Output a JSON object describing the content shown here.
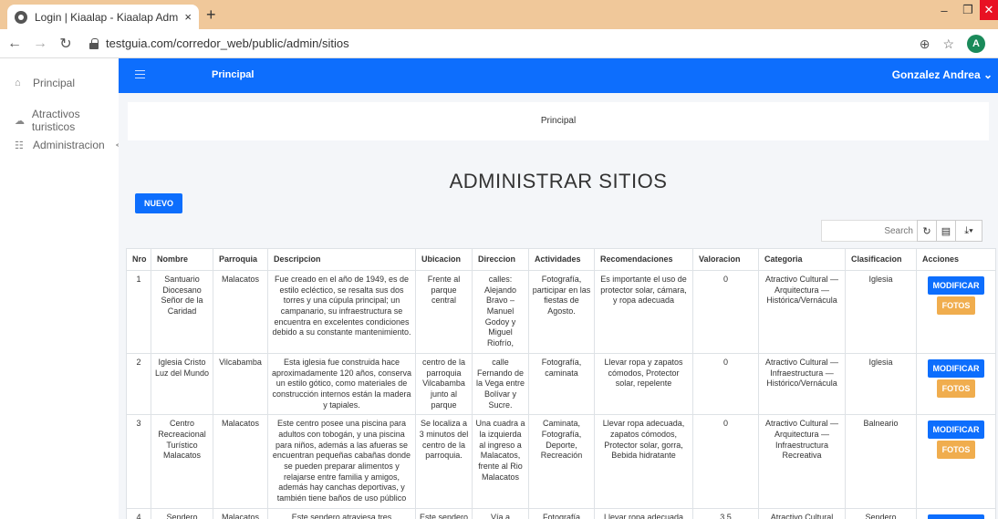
{
  "browser": {
    "tab_title": "Login | Kiaalap - Kiaalap Admin T",
    "close": "×",
    "new_tab": "+",
    "url": "testguia.com/corredor_web/public/admin/sitios",
    "avatar_letter": "A"
  },
  "sidebar": {
    "items": [
      {
        "label": "Principal",
        "icon": "home-icon"
      },
      {
        "label": "Atractivos turisticos",
        "icon": "cloud-icon"
      },
      {
        "label": "Administracion",
        "icon": "admin-icon",
        "caret": "<"
      }
    ]
  },
  "topnav": {
    "title": "Principal",
    "user": "Gonzalez Andrea ⌄"
  },
  "breadcrumb": "Principal",
  "page_title": "ADMINISTRAR SITIOS",
  "nuevo_label": "NUEVO",
  "search_placeholder": "Search",
  "table": {
    "headers": [
      "Nro",
      "Nombre",
      "Parroquia",
      "Descripcion",
      "Ubicacion",
      "Direccion",
      "Actividades",
      "Recomendaciones",
      "Valoracion",
      "Categoria",
      "Clasificacion",
      "Acciones"
    ],
    "rows": [
      {
        "nro": "1",
        "nombre": "Santuario Diocesano Señor de la Caridad",
        "parroquia": "Malacatos",
        "descripcion": "Fue creado en el año de 1949, es de estilo ecléctico, se resalta sus dos torres y una cúpula principal; un campanario, su infraestructura se encuentra en excelentes condiciones debido a su constante mantenimiento.",
        "ubicacion": "Frente al parque central",
        "direccion": "calles: Alejando Bravo – Manuel Godoy y Miguel Riofrío,",
        "actividades": "Fotografía, participar en las fiestas de Agosto.",
        "recomendaciones": "Es importante el uso de protector solar, cámara, y ropa adecuada",
        "valoracion": "0",
        "categoria": "Atractivo Cultural — Arquitectura — Histórica/Vernácula",
        "clasificacion": "Iglesia"
      },
      {
        "nro": "2",
        "nombre": "Iglesia Cristo Luz del Mundo",
        "parroquia": "Vilcabamba",
        "descripcion": "Esta iglesia fue construida hace aproximadamente 120 años, conserva un estilo gótico, como materiales de construcción internos están la madera y tapiales.",
        "ubicacion": "centro de la parroquia Vilcabamba junto al parque",
        "direccion": "calle Fernando de la Vega entre Bolívar y Sucre.",
        "actividades": "Fotografía, caminata",
        "recomendaciones": "Llevar ropa y zapatos cómodos, Protector solar, repelente",
        "valoracion": "0",
        "categoria": "Atractivo Cultural — Infraestructura — Histórico/Vernácula",
        "clasificacion": "Iglesia"
      },
      {
        "nro": "3",
        "nombre": "Centro Recreacional Turístico Malacatos",
        "parroquia": "Malacatos",
        "descripcion": "Este centro posee una piscina para adultos con tobogán, y una piscina para niños, además a las afueras se encuentran pequeñas cabañas donde se pueden preparar alimentos y relajarse entre familia y amigos, además hay canchas deportivas, y también tiene baños de uso público",
        "ubicacion": "Se localiza a 3 minutos del centro de la parroquia.",
        "direccion": "Una cuadra a la izquierda al ingreso a Malacatos, frente al Rio Malacatos",
        "actividades": "Caminata, Fotografía, Deporte, Recreación",
        "recomendaciones": "Llevar ropa adecuada, zapatos cómodos, Protector solar, gorra, Bebida hidratante",
        "valoracion": "0",
        "categoria": "Atractivo Cultural — Arquitectura — Infraestructura Recreativa",
        "clasificacion": "Balneario"
      },
      {
        "nro": "4",
        "nombre": "Sendero",
        "parroquia": "Malacatos",
        "descripcion": "Este sendero atraviesa tres comunidades",
        "ubicacion": "Este sendero",
        "direccion": "Vía a Malacatos",
        "actividades": "Fotografía",
        "recomendaciones": "Llevar ropa adecuada",
        "valoracion": "3.5",
        "categoria": "Atractivo Cultural",
        "clasificacion": "Sendero"
      }
    ],
    "action_modify": "MODIFICAR",
    "action_photos": "FOTOS"
  }
}
